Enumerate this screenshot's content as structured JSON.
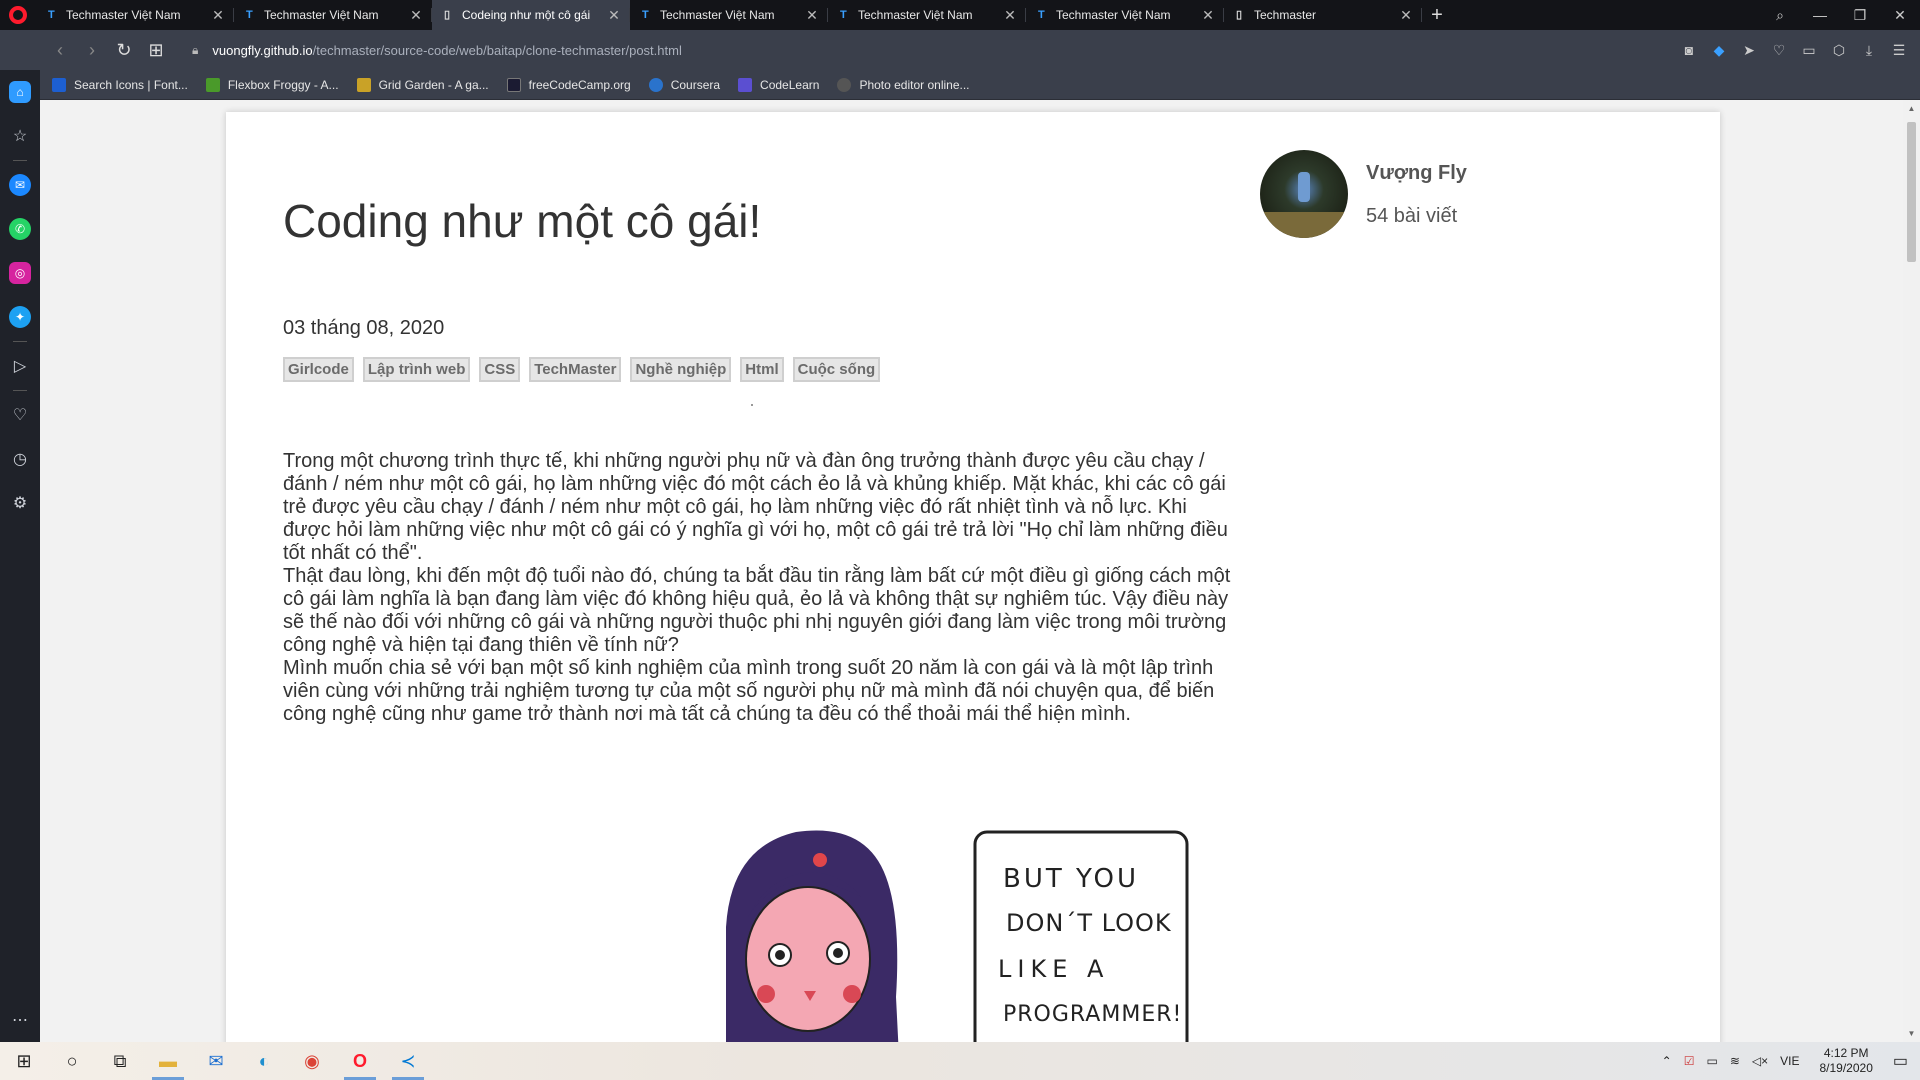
{
  "browser": {
    "tabs": [
      {
        "title": "Techmaster Việt Nam",
        "active": false
      },
      {
        "title": "Techmaster Việt Nam",
        "active": false
      },
      {
        "title": "Codeing như một cô gái",
        "active": true
      },
      {
        "title": "Techmaster Việt Nam",
        "active": false
      },
      {
        "title": "Techmaster Việt Nam",
        "active": false
      },
      {
        "title": "Techmaster Việt Nam",
        "active": false
      },
      {
        "title": "Techmaster",
        "active": false
      }
    ],
    "url_host": "vuongfly.github.io",
    "url_path": "/techmaster/source-code/web/baitap/clone-techmaster/post.html",
    "bookmarks": [
      {
        "label": "Search Icons | Font...",
        "color": "#1d5fd1"
      },
      {
        "label": "Flexbox Froggy - A...",
        "color": "#4a9a2a"
      },
      {
        "label": "Grid Garden - A ga...",
        "color": "#c9a227"
      },
      {
        "label": "freeCodeCamp.org",
        "color": "#1b1b32"
      },
      {
        "label": "Coursera",
        "color": "#2a73cc"
      },
      {
        "label": "CodeLearn",
        "color": "#5b4fd1"
      },
      {
        "label": "Photo editor online...",
        "color": "#555555"
      }
    ]
  },
  "post": {
    "title": "Coding như một cô gái!",
    "date": "03 tháng 08, 2020",
    "tags": [
      "Girlcode",
      "Lập trình web",
      "CSS",
      "TechMaster",
      "Nghề nghiệp",
      "Html",
      "Cuộc sống"
    ],
    "paragraphs": [
      "Trong một chương trình thực tế, khi những người phụ nữ và đàn ông trưởng thành được yêu cầu chạy / đánh / ném như một cô gái, họ làm những việc đó một cách ẻo lả và khủng khiếp. Mặt khác, khi các cô gái trẻ được yêu cầu chạy / đánh / ném như một cô gái, họ làm những việc đó rất nhiệt tình và nỗ lực. Khi được hỏi làm những việc như một cô gái có ý nghĩa gì với họ, một cô gái trẻ trả lời \"Họ chỉ làm những điều tốt nhất có thể\".",
      "Thật đau lòng, khi đến một độ tuổi nào đó, chúng ta bắt đầu tin rằng làm bất cứ một điều gì giống cách một cô gái làm nghĩa là bạn đang làm việc đó không hiệu quả, ẻo lả và không thật sự nghiêm túc. Vậy điều này sẽ thế nào đối với những cô gái và những người thuộc phi nhị nguyên giới đang làm việc trong môi trường công nghệ và hiện tại đang thiên về tính nữ?",
      "Mình muốn chia sẻ với bạn một số kinh nghiệm của mình trong suốt 20 năm là con gái và là một lập trình viên cùng với những trải nghiệm tương tự của một số người phụ nữ mà mình đã nói chuyện qua, để biến công nghệ cũng như game trở thành nơi mà tất cả chúng ta đều có thể thoải mái thể hiện mình."
    ],
    "comic_text": [
      "BUT YOU",
      "DON´T LOOK",
      "LIKE A",
      "PROGRAMMER!"
    ]
  },
  "author": {
    "name": "Vượng Fly",
    "post_count": "54 bài viết"
  },
  "taskbar": {
    "language": "VIE",
    "time": "4:12 PM",
    "date": "8/19/2020"
  }
}
